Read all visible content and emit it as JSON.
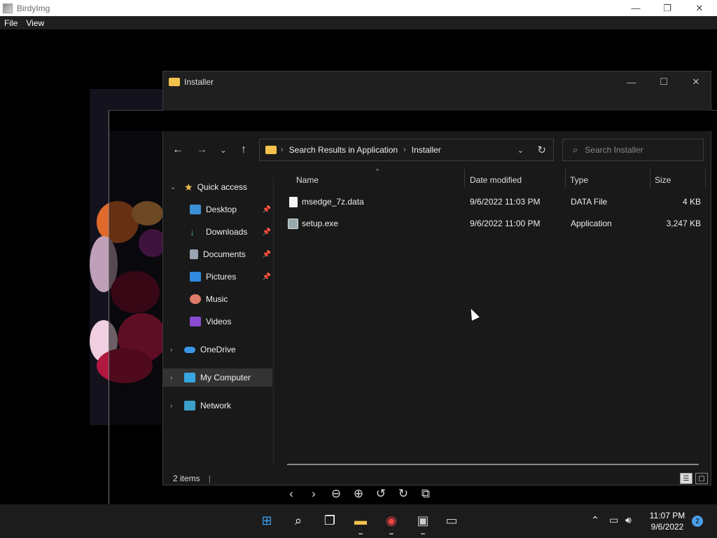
{
  "app": {
    "title": "BirdyImg",
    "menu": [
      "File",
      "View"
    ]
  },
  "explorer": {
    "title": "Installer",
    "breadcrumb": [
      "Search Results in Application",
      "Installer"
    ],
    "search_placeholder": "Search Installer",
    "columns": [
      "Name",
      "Date modified",
      "Type",
      "Size"
    ],
    "files": [
      {
        "name": "msedge_7z.data",
        "date": "9/6/2022 11:03 PM",
        "type": "DATA File",
        "size": "4 KB",
        "icon": "file-icon"
      },
      {
        "name": "setup.exe",
        "date": "9/6/2022 11:00 PM",
        "type": "Application",
        "size": "3,247 KB",
        "icon": "exe-icon"
      }
    ],
    "sidebar": {
      "quick_access": "Quick access",
      "items": [
        {
          "label": "Desktop",
          "icon": "desktop-icon",
          "pinned": true
        },
        {
          "label": "Downloads",
          "icon": "download-icon",
          "pinned": true
        },
        {
          "label": "Documents",
          "icon": "document-icon",
          "pinned": true
        },
        {
          "label": "Pictures",
          "icon": "pictures-icon",
          "pinned": true
        },
        {
          "label": "Music",
          "icon": "music-icon",
          "pinned": false
        },
        {
          "label": "Videos",
          "icon": "videos-icon",
          "pinned": false
        }
      ],
      "onedrive": "OneDrive",
      "my_computer": "My Computer",
      "network": "Network"
    },
    "status": "2 items"
  },
  "taskbar": {
    "time": "11:07 PM",
    "date": "9/6/2022",
    "notifications": "2"
  },
  "colors": {
    "folder": "#f2c14b",
    "accent": "#4c9ee8",
    "selected": "#333333"
  }
}
